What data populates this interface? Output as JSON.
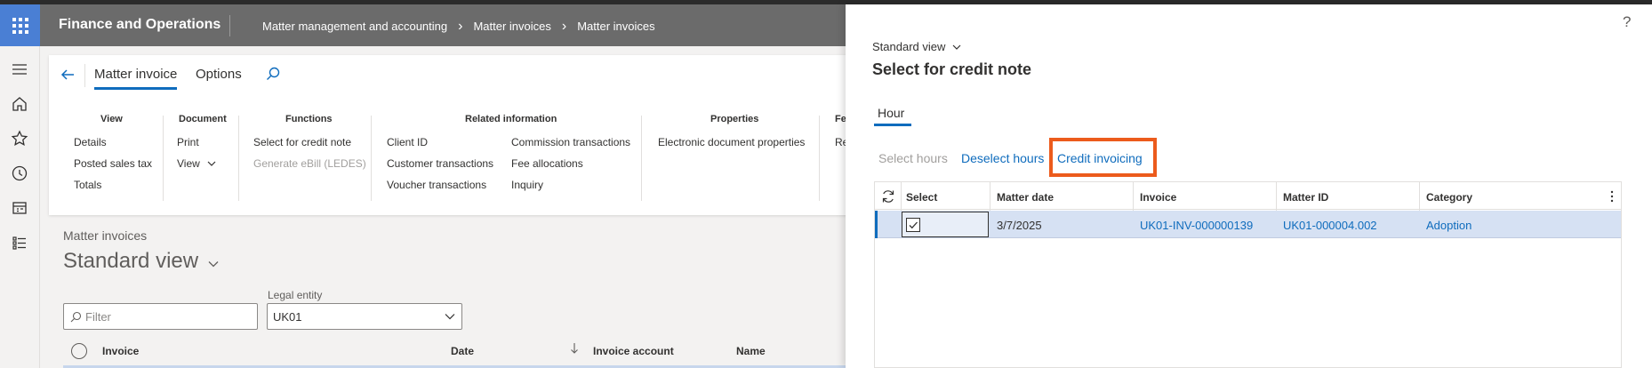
{
  "topbar": {
    "app_title": "Finance and Operations",
    "breadcrumb": [
      "Matter management and accounting",
      "Matter invoices",
      "Matter invoices"
    ]
  },
  "action_pane": {
    "tabs": [
      "Matter invoice",
      "Options"
    ],
    "groups": {
      "view": {
        "title": "View",
        "items": [
          "Details",
          "Posted sales tax",
          "Totals"
        ]
      },
      "document": {
        "title": "Document",
        "items": [
          "Print",
          "View"
        ]
      },
      "functions": {
        "title": "Functions",
        "items": [
          "Select for credit note",
          "Generate eBill (LEDES)"
        ]
      },
      "related": {
        "title": "Related information",
        "col1": [
          "Client ID",
          "Customer transactions",
          "Voucher transactions"
        ],
        "col2": [
          "Commission transactions",
          "Fee allocations",
          "Inquiry"
        ]
      },
      "properties": {
        "title": "Properties",
        "items": [
          "Electronic document properties"
        ]
      },
      "truncated": {
        "title": "Fe",
        "items": [
          "Re"
        ]
      }
    }
  },
  "page": {
    "caption": "Matter invoices",
    "view_name": "Standard view",
    "filter_placeholder": "Filter",
    "legal_entity_label": "Legal entity",
    "legal_entity_value": "UK01",
    "columns": [
      "Invoice",
      "Date",
      "Invoice account",
      "Name"
    ]
  },
  "panel": {
    "view_selector": "Standard view",
    "title": "Select for credit note",
    "help": "?",
    "tab": "Hour",
    "buttons": {
      "select_hours": "Select hours",
      "deselect_hours": "Deselect hours",
      "credit_invoicing": "Credit invoicing"
    },
    "grid": {
      "columns": [
        "Select",
        "Matter date",
        "Invoice",
        "Matter ID",
        "Category"
      ],
      "rows": [
        {
          "matter_date": "3/7/2025",
          "invoice": "UK01-INV-000000139",
          "matter_id": "UK01-000004.002",
          "category": "Adoption",
          "selected": true
        }
      ]
    }
  },
  "colors": {
    "accent": "#0f6cbd",
    "highlight": "#ec5b1c",
    "waffle": "#4a7fd4",
    "topbar": "#6b6b6b"
  }
}
